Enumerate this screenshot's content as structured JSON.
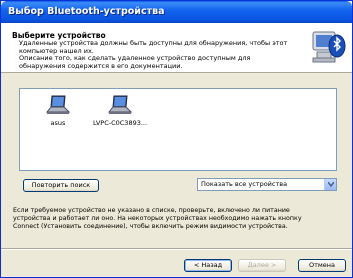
{
  "window": {
    "title": "Выбор Bluetooth-устройства"
  },
  "header": {
    "title": "Выберите устройство",
    "desc_lines": [
      "Удаленные устройства должны быть доступны для обнаружения, чтобы этот",
      "компьютер нашел их.",
      "Описание того, как сделать удаленное устройство доступным для",
      "обнаружения содержится в его документации."
    ],
    "icon": "bluetooth-computer-icon"
  },
  "devices": [
    {
      "label": "asus",
      "icon": "laptop-icon"
    },
    {
      "label": "LVPC-C0C3893...",
      "icon": "laptop-icon"
    }
  ],
  "controls": {
    "retry_search_label": "Повторить поиск",
    "filter": {
      "value": "Показать все устройства"
    }
  },
  "info_lines": [
    "Если требуемое устройство не указано в списке, проверьте, включено ли питание",
    "устройства и работает ли оно. На некоторых устройствах необходимо нажать кнопку",
    "Connect (Установить соединение), чтобы включить режим видимости устройства."
  ],
  "footer": {
    "back_label": "< Назад",
    "next_label": "Далее >",
    "cancel_label": "Отмена"
  },
  "colors": {
    "accent": "#0a54e0",
    "face": "#ece9d8"
  }
}
